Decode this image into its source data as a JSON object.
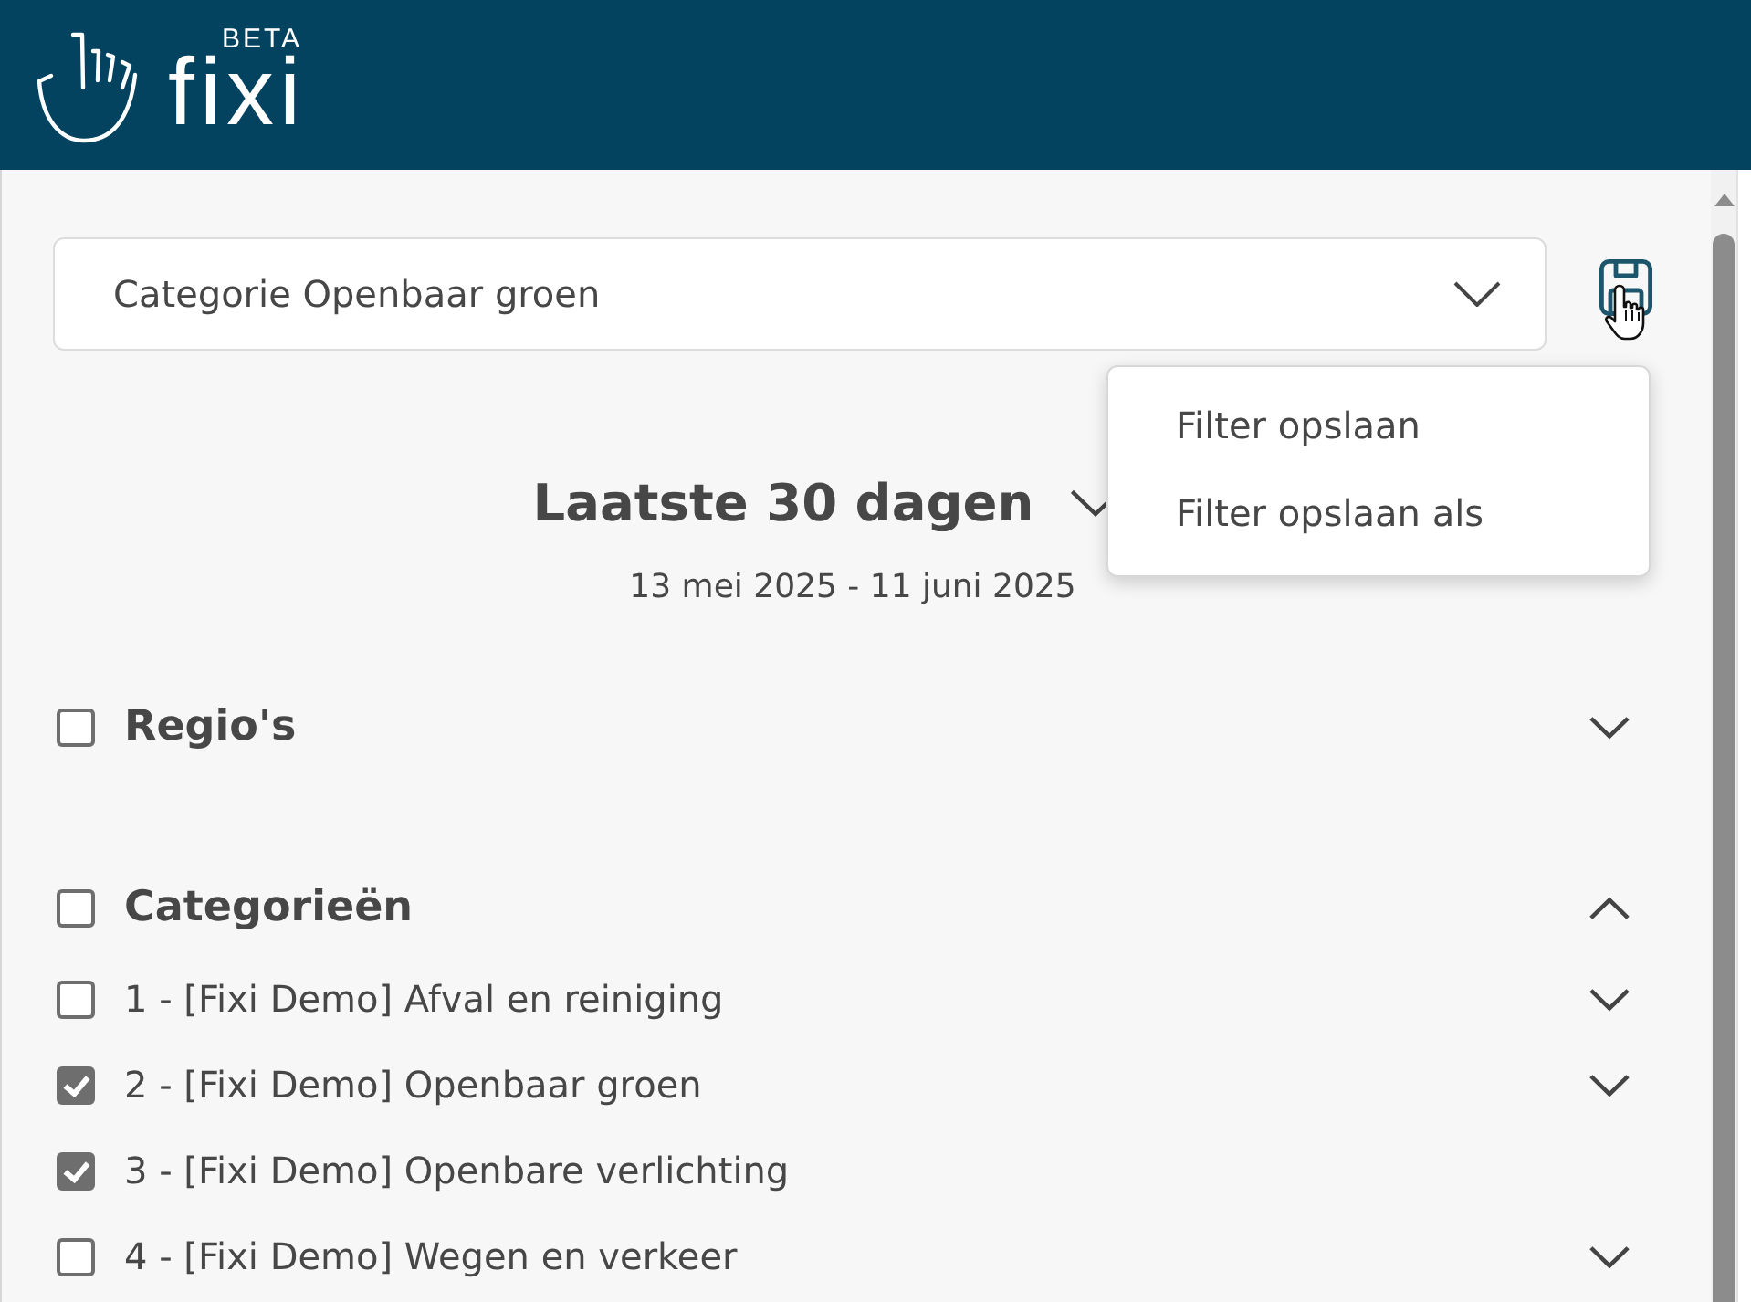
{
  "header": {
    "logo": "fixi",
    "badge": "BETA"
  },
  "filter": {
    "value": "Categorie Openbaar groen"
  },
  "save_menu": {
    "open": true,
    "items": [
      "Filter opslaan",
      "Filter opslaan als"
    ]
  },
  "period": {
    "title": "Laatste 30 dagen",
    "range": "13 mei 2025 - 11 juni 2025"
  },
  "sections": [
    {
      "label": "Regio's",
      "checked": false,
      "expanded": false
    },
    {
      "label": "Categorieën",
      "checked": false,
      "expanded": true,
      "children": [
        {
          "label": "1 - [Fixi Demo] Afval en reiniging",
          "checked": false,
          "expandable": true
        },
        {
          "label": "2 - [Fixi Demo] Openbaar groen",
          "checked": true,
          "expandable": true
        },
        {
          "label": "3 - [Fixi Demo] Openbare verlichting",
          "checked": true,
          "expandable": false
        },
        {
          "label": "4 - [Fixi Demo] Wegen en verkeer",
          "checked": false,
          "expandable": true
        }
      ]
    }
  ]
}
